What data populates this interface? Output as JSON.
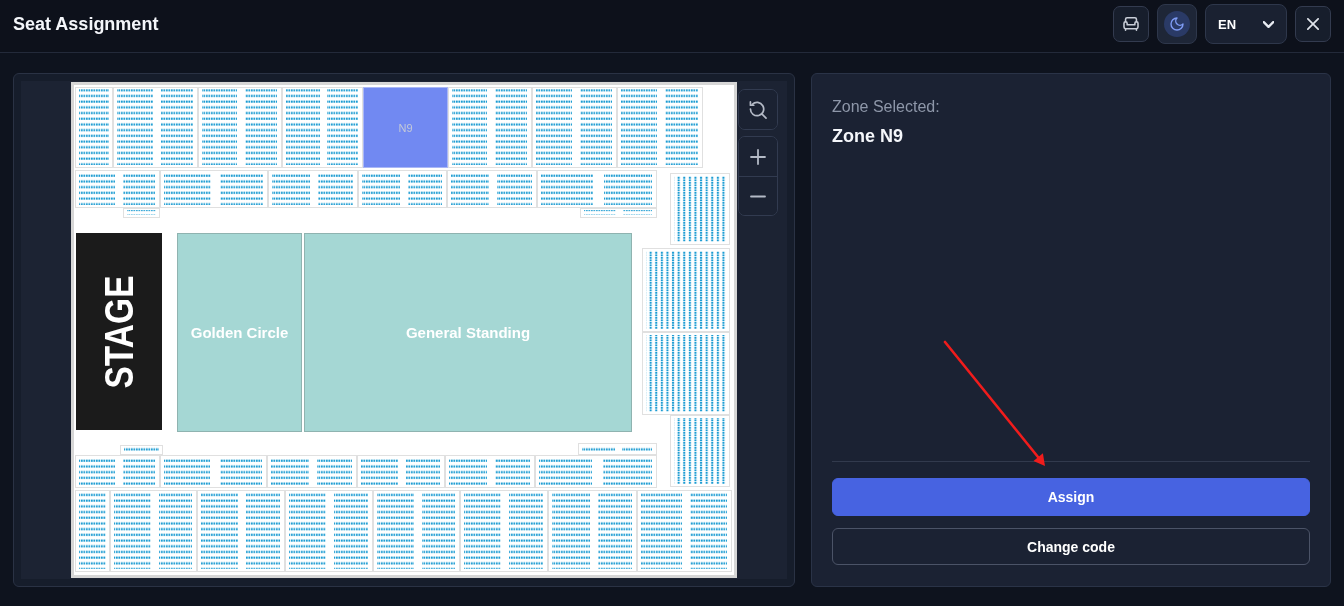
{
  "window": {
    "title": "Seat Assignment"
  },
  "toolbar": {
    "theme_toggle": {
      "on": true
    },
    "language": {
      "value": "EN"
    }
  },
  "seat_map": {
    "stage": {
      "label": "STAGE"
    },
    "standing_areas": [
      {
        "label": "Golden Circle",
        "selected": false
      },
      {
        "label": "General Standing",
        "selected": false
      }
    ],
    "sections": [
      {
        "selected": false
      },
      {
        "selected": false
      },
      {
        "selected": false
      },
      {
        "selected": false
      },
      {
        "label": "N9",
        "selected": true
      },
      {
        "selected": false
      },
      {
        "selected": false
      },
      {
        "selected": false
      },
      {
        "selected": false
      },
      {
        "selected": false
      },
      {
        "selected": false
      },
      {
        "selected": false
      },
      {
        "selected": false
      },
      {
        "selected": false
      },
      {
        "selected": false
      },
      {
        "selected": false
      },
      {
        "selected": false
      },
      {
        "selected": false
      },
      {
        "selected": false
      },
      {
        "selected": false
      },
      {
        "selected": false
      },
      {
        "selected": false
      },
      {
        "selected": false
      },
      {
        "selected": false
      },
      {
        "selected": false
      },
      {
        "selected": false
      },
      {
        "selected": false
      },
      {
        "selected": false
      },
      {
        "selected": false
      },
      {
        "selected": false
      },
      {
        "selected": false
      },
      {
        "selected": false
      }
    ]
  },
  "zone_panel": {
    "heading": "Zone Selected:",
    "zone_name": "Zone N9",
    "buttons": [
      {
        "label": "Assign",
        "kind": "primary"
      },
      {
        "label": "Change code",
        "kind": "secondary"
      }
    ]
  }
}
